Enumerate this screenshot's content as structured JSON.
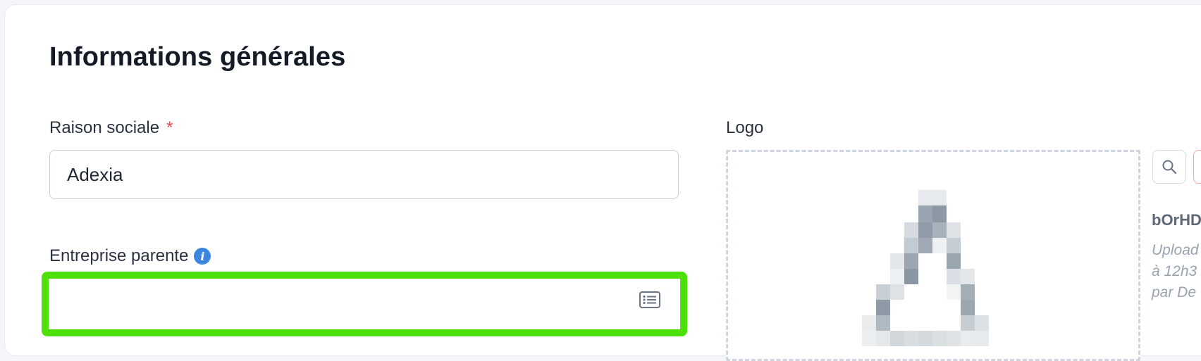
{
  "section": {
    "title": "Informations générales"
  },
  "raison_sociale": {
    "label": "Raison sociale",
    "required_mark": "*",
    "value": "Adexia"
  },
  "entreprise_parente": {
    "label": "Entreprise parente",
    "info_icon": "i",
    "value": "",
    "picker_icon": "list-icon"
  },
  "logo": {
    "label": "Logo",
    "preview_button_icon": "search-icon",
    "file_name": "bOrHD",
    "meta_line_1": "Upload",
    "meta_line_2": "à 12h3",
    "meta_line_3": "par De"
  },
  "colors": {
    "highlight": "#4de00b",
    "required": "#e5484d",
    "info": "#3d86e0"
  }
}
